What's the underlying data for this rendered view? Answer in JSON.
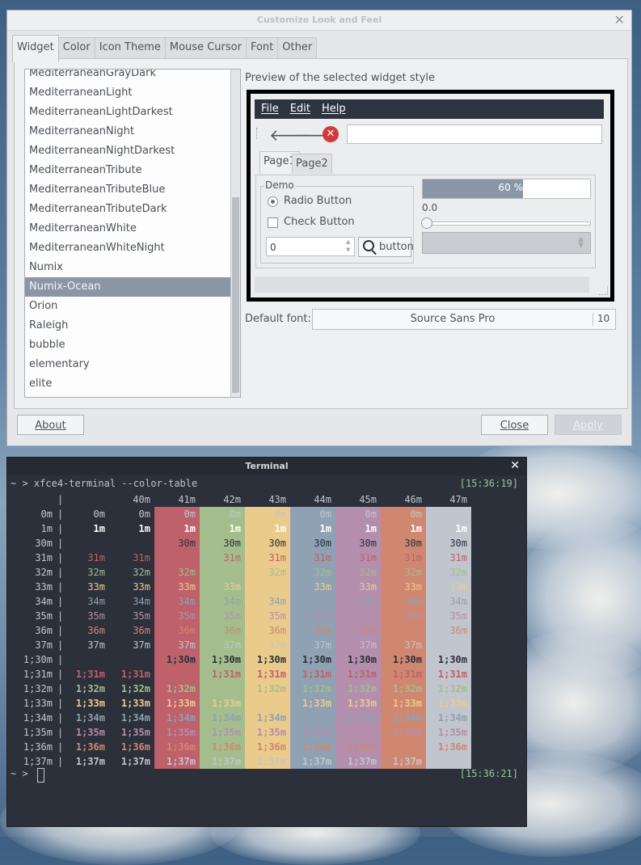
{
  "dialog": {
    "title": "Customize Look and Feel",
    "close_glyph": "✕",
    "tabs": [
      "Widget",
      "Color",
      "Icon Theme",
      "Mouse Cursor",
      "Font",
      "Other"
    ],
    "active_tab": "Widget",
    "styles": [
      "MediterraneanGrayDark",
      "MediterraneanLight",
      "MediterraneanLightDarkest",
      "MediterraneanNight",
      "MediterraneanNightDarkest",
      "MediterraneanTribute",
      "MediterraneanTributeBlue",
      "MediterraneanTributeDark",
      "MediterraneanWhite",
      "MediterraneanWhiteNight",
      "Numix",
      "Numix-Ocean",
      "Orion",
      "Raleigh",
      "bubble",
      "elementary",
      "elite"
    ],
    "selected_style": "Numix-Ocean",
    "preview_label": "Preview of the selected widget style",
    "preview": {
      "menu": [
        "File",
        "Edit",
        "Help"
      ],
      "back_glyph": "🡐",
      "forward_glyph": "🡒",
      "stop_glyph": "✕",
      "tabs": [
        "Page1",
        "Page2"
      ],
      "group_title": "Demo",
      "radio_label": "Radio Button",
      "check_label": "Check Button",
      "spin_value": "0",
      "button_label": "button",
      "progress_text": "60 %",
      "progress_value": 0.6,
      "slider_value": "0.0"
    },
    "default_font_label": "Default font:",
    "font_name": "Source Sans Pro",
    "font_size": "10",
    "about_label": "About",
    "close_label": "Close",
    "apply_label": "Apply"
  },
  "terminal": {
    "title": "Terminal",
    "close_glyph": "✕",
    "prompt": "~ >",
    "command": "xfce4-terminal --color-table",
    "time_start": "[15:36:19]",
    "time_end": "[15:36:21]",
    "bar": "|",
    "bg_headers": [
      "",
      "40m",
      "41m",
      "42m",
      "43m",
      "44m",
      "45m",
      "46m",
      "47m"
    ],
    "row_labels": [
      "0m",
      "1m",
      "30m",
      "31m",
      "32m",
      "33m",
      "34m",
      "35m",
      "36m",
      "37m",
      "1;30m",
      "1;31m",
      "1;32m",
      "1;33m",
      "1;34m",
      "1;35m",
      "1;36m",
      "1;37m"
    ],
    "bg_colors": [
      "#2b303b",
      "#2b303b",
      "#bf616a",
      "#a3be8c",
      "#ebcb8b",
      "#8fa1b3",
      "#b48ead",
      "#d08770",
      "#c0c5ce"
    ],
    "fg_colors": {
      "0m": "#c0c5ce",
      "1m": "#ffffff",
      "30m": "#2b303b",
      "31m": "#bf616a",
      "32m": "#a3be8c",
      "33m": "#ebcb8b",
      "34m": "#8fa1b3",
      "35m": "#b48ead",
      "36m": "#d08770",
      "37m": "#c0c5ce"
    }
  }
}
